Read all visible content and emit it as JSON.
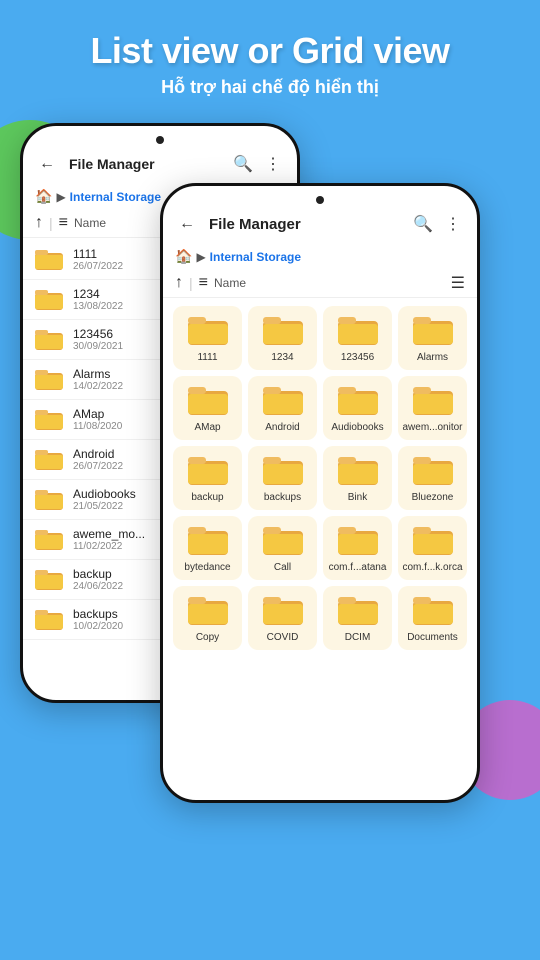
{
  "header": {
    "title": "List view or Grid view",
    "subtitle": "Hỗ trợ hai chế độ hiển thị"
  },
  "phone_back": {
    "app_title": "File Manager",
    "breadcrumb": "Internal Storage",
    "sort_label": "Name",
    "items": [
      {
        "name": "1111",
        "date": "26/07/2022"
      },
      {
        "name": "1234",
        "date": "13/08/2022"
      },
      {
        "name": "123456",
        "date": "30/09/2021"
      },
      {
        "name": "Alarms",
        "date": "14/02/2022"
      },
      {
        "name": "AMap",
        "date": "11/08/2020"
      },
      {
        "name": "Android",
        "date": "26/07/2022"
      },
      {
        "name": "Audiobooks",
        "date": "21/05/2022"
      },
      {
        "name": "aweme_mo...",
        "date": "11/02/2022"
      },
      {
        "name": "backup",
        "date": "24/06/2022"
      },
      {
        "name": "backups",
        "date": "10/02/2020"
      }
    ]
  },
  "phone_front": {
    "app_title": "File Manager",
    "breadcrumb": "Internal Storage",
    "sort_label": "Name",
    "grid_items": [
      "1111",
      "1234",
      "123456",
      "Alarms",
      "AMap",
      "Android",
      "Audiobooks",
      "awem...onitor",
      "backup",
      "backups",
      "Bink",
      "Bluezone",
      "bytedance",
      "Call",
      "com.f...atana",
      "com.f...k.orca",
      "Copy",
      "COVID",
      "DCIM",
      "Documents"
    ]
  }
}
